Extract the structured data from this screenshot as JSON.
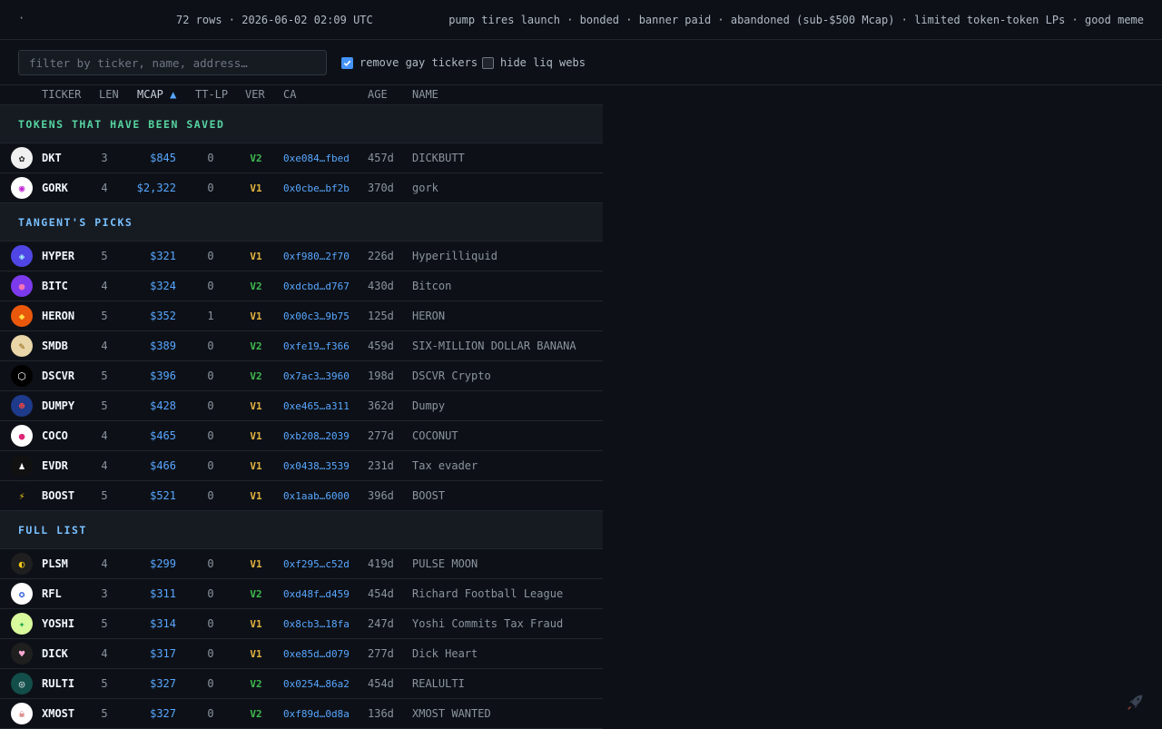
{
  "header": {
    "dot": "·",
    "rows_info": "72 rows · 2026-06-02 02:09 UTC",
    "tags": "pump tires launch · bonded · banner paid · abandoned (sub-$500 Mcap) · limited token-token LPs · good meme"
  },
  "filter": {
    "placeholder": "filter by ticker, name, address…",
    "value": "",
    "checkbox1": {
      "label": "remove gay tickers",
      "checked": true
    },
    "checkbox2": {
      "label": "hide liq webs",
      "checked": false
    }
  },
  "columns": {
    "ticker": "TICKER",
    "len": "LEN",
    "mcap": "MCAP",
    "mcap_sort": "▲",
    "ttlp": "TT-LP",
    "ver": "VER",
    "ca": "CA",
    "age": "AGE",
    "name": "NAME"
  },
  "colors": {
    "saved": "#3fb950",
    "picks": "#58a6ff",
    "full": "#58a6ff",
    "v1": "#e3b341",
    "v2": "#3fb950",
    "accent": "#58a6ff"
  },
  "sections": [
    {
      "title": "TOKENS THAT HAVE BEEN SAVED",
      "color": "#56d4a0",
      "rows": [
        {
          "ticker": "DKT",
          "len": "3",
          "mcap": "$845",
          "ttlp": "0",
          "ver": "V2",
          "ca": "0xe084…fbed",
          "age": "457d",
          "name": "DICKBUTT",
          "icon": "dickbutt-logo-icon",
          "logo_bg": "#f0f0f0",
          "logo_glyph": "✿",
          "logo_fg": "#222"
        },
        {
          "ticker": "GORK",
          "len": "4",
          "mcap": "$2,322",
          "ttlp": "0",
          "ver": "V1",
          "ca": "0x0cbe…bf2b",
          "age": "370d",
          "name": "gork",
          "icon": "gork-logo-icon",
          "logo_bg": "#ffffff",
          "logo_glyph": "◉",
          "logo_fg": "#c026d3"
        }
      ]
    },
    {
      "title": "TANGENT'S PICKS",
      "color": "#79c0ff",
      "rows": [
        {
          "ticker": "HYPER",
          "len": "5",
          "mcap": "$321",
          "ttlp": "0",
          "ver": "V1",
          "ca": "0xf980…2f70",
          "age": "226d",
          "name": "Hyperilliquid",
          "icon": "hyper-logo-icon",
          "logo_bg": "#4f46e5",
          "logo_glyph": "◈",
          "logo_fg": "#a5f3fc"
        },
        {
          "ticker": "BITC",
          "len": "4",
          "mcap": "$324",
          "ttlp": "0",
          "ver": "V2",
          "ca": "0xdcbd…d767",
          "age": "430d",
          "name": "Bitcon",
          "icon": "bitcon-logo-icon",
          "logo_bg": "#7c3aed",
          "logo_glyph": "●",
          "logo_fg": "#f472b6"
        },
        {
          "ticker": "HERON",
          "len": "5",
          "mcap": "$352",
          "ttlp": "1",
          "ver": "V1",
          "ca": "0x00c3…9b75",
          "age": "125d",
          "name": "HERON",
          "icon": "heron-logo-icon",
          "logo_bg": "#ea580c",
          "logo_glyph": "◆",
          "logo_fg": "#fde047"
        },
        {
          "ticker": "SMDB",
          "len": "4",
          "mcap": "$389",
          "ttlp": "0",
          "ver": "V2",
          "ca": "0xfe19…f366",
          "age": "459d",
          "name": "SIX-MILLION DOLLAR BANANA",
          "icon": "banana-logo-icon",
          "logo_bg": "#e8d5a8",
          "logo_glyph": "✎",
          "logo_fg": "#8a5a00"
        },
        {
          "ticker": "DSCVR",
          "len": "5",
          "mcap": "$396",
          "ttlp": "0",
          "ver": "V2",
          "ca": "0x7ac3…3960",
          "age": "198d",
          "name": "DSCVR Crypto",
          "icon": "dscvr-logo-icon",
          "logo_bg": "#000000",
          "logo_glyph": "⬡",
          "logo_fg": "#ffffff"
        },
        {
          "ticker": "DUMPY",
          "len": "5",
          "mcap": "$428",
          "ttlp": "0",
          "ver": "V1",
          "ca": "0xe465…a311",
          "age": "362d",
          "name": "Dumpy",
          "icon": "dumpy-logo-icon",
          "logo_bg": "#1e3a8a",
          "logo_glyph": "☻",
          "logo_fg": "#ef4444"
        },
        {
          "ticker": "COCO",
          "len": "4",
          "mcap": "$465",
          "ttlp": "0",
          "ver": "V1",
          "ca": "0xb208…2039",
          "age": "277d",
          "name": "COCONUT",
          "icon": "coconut-logo-icon",
          "logo_bg": "#ffffff",
          "logo_glyph": "●",
          "logo_fg": "#db2777"
        },
        {
          "ticker": "EVDR",
          "len": "4",
          "mcap": "$466",
          "ttlp": "0",
          "ver": "V1",
          "ca": "0x0438…3539",
          "age": "231d",
          "name": "Tax evader",
          "icon": "tax-evader-logo-icon",
          "logo_bg": "#111111",
          "logo_glyph": "♟",
          "logo_fg": "#ffffff"
        },
        {
          "ticker": "BOOST",
          "len": "5",
          "mcap": "$521",
          "ttlp": "0",
          "ver": "V1",
          "ca": "0x1aab…6000",
          "age": "396d",
          "name": "BOOST",
          "icon": "lightning-logo-icon",
          "logo_bg": "#0d1117",
          "logo_glyph": "⚡",
          "logo_fg": "#facc15"
        }
      ]
    },
    {
      "title": "FULL LIST",
      "color": "#79c0ff",
      "rows": [
        {
          "ticker": "PLSM",
          "len": "4",
          "mcap": "$299",
          "ttlp": "0",
          "ver": "V1",
          "ca": "0xf295…c52d",
          "age": "419d",
          "name": "PULSE MOON",
          "icon": "pulse-moon-logo-icon",
          "logo_bg": "#1f1f1f",
          "logo_glyph": "◐",
          "logo_fg": "#facc15"
        },
        {
          "ticker": "RFL",
          "len": "3",
          "mcap": "$311",
          "ttlp": "0",
          "ver": "V2",
          "ca": "0xd48f…d459",
          "age": "454d",
          "name": "Richard Football League",
          "icon": "rfl-logo-icon",
          "logo_bg": "#ffffff",
          "logo_glyph": "✪",
          "logo_fg": "#1d4ed8"
        },
        {
          "ticker": "YOSHI",
          "len": "5",
          "mcap": "$314",
          "ttlp": "0",
          "ver": "V1",
          "ca": "0x8cb3…18fa",
          "age": "247d",
          "name": "Yoshi Commits Tax Fraud",
          "icon": "yoshi-logo-icon",
          "logo_bg": "#d9f99d",
          "logo_glyph": "✦",
          "logo_fg": "#16a34a"
        },
        {
          "ticker": "DICK",
          "len": "4",
          "mcap": "$317",
          "ttlp": "0",
          "ver": "V1",
          "ca": "0xe85d…d079",
          "age": "277d",
          "name": "Dick Heart",
          "icon": "dick-heart-logo-icon",
          "logo_bg": "#1f1f1f",
          "logo_glyph": "♥",
          "logo_fg": "#f9a8d4"
        },
        {
          "ticker": "RULTI",
          "len": "5",
          "mcap": "$327",
          "ttlp": "0",
          "ver": "V2",
          "ca": "0x0254…86a2",
          "age": "454d",
          "name": "REALULTI",
          "icon": "realulti-logo-icon",
          "logo_bg": "#134e4a",
          "logo_glyph": "◎",
          "logo_fg": "#e5e7eb"
        },
        {
          "ticker": "XMOST",
          "len": "5",
          "mcap": "$327",
          "ttlp": "0",
          "ver": "V2",
          "ca": "0xf89d…0d8a",
          "age": "136d",
          "name": "XMOST WANTED",
          "icon": "xmost-logo-icon",
          "logo_bg": "#ffffff",
          "logo_glyph": "☠",
          "logo_fg": "#b91c1c"
        }
      ]
    }
  ]
}
